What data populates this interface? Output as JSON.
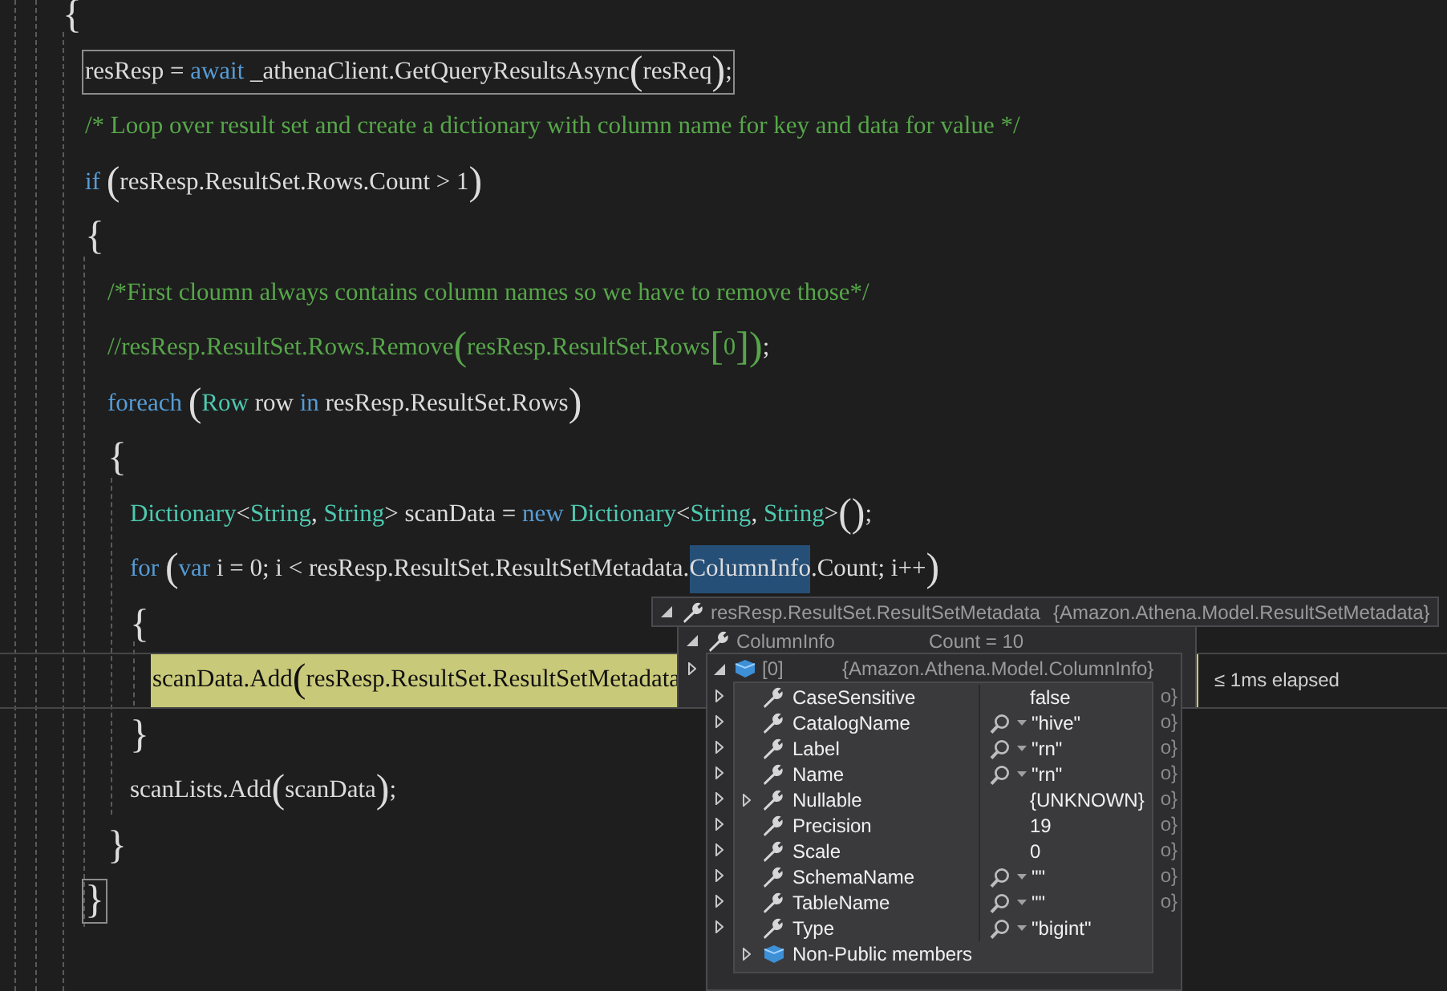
{
  "code": [
    {
      "tokens": [
        {
          "text": "{",
          "kind": "brace"
        }
      ],
      "boxed": false,
      "current": false
    },
    {
      "children": [
        {
          "tokens": [
            {
              "text": "resResp = ",
              "kind": "plain"
            },
            {
              "text": "await",
              "kind": "keyword"
            },
            {
              "text": " _athenaClient.GetQueryResultsAsync",
              "kind": "plain"
            },
            {
              "text": "(",
              "kind": "paren"
            },
            {
              "text": "resReq",
              "kind": "plain"
            },
            {
              "text": ")",
              "kind": "paren"
            },
            {
              "text": ";",
              "kind": "plain"
            }
          ],
          "boxed": true,
          "current": false
        },
        {
          "tokens": [
            {
              "text": "/* Loop over result set and create a dictionary with column name for key and data for value */",
              "kind": "comment"
            }
          ],
          "boxed": false,
          "current": false
        },
        {
          "tokens": [
            {
              "text": "if ",
              "kind": "keyword"
            },
            {
              "text": "(",
              "kind": "paren"
            },
            {
              "text": "resResp.ResultSet.Rows.Count > 1",
              "kind": "plain"
            },
            {
              "text": ")",
              "kind": "paren"
            }
          ],
          "boxed": false,
          "current": false
        },
        {
          "tokens": [
            {
              "text": "{",
              "kind": "brace"
            }
          ],
          "boxed": false,
          "current": false
        },
        {
          "children": [
            {
              "tokens": [
                {
                  "text": "/*First cloumn always contains column names so we have to remove those*/",
                  "kind": "comment"
                }
              ],
              "boxed": false,
              "current": false
            },
            {
              "tokens": [
                {
                  "text": "//resResp.ResultSet.Rows.Remove",
                  "kind": "comment"
                },
                {
                  "text": "(",
                  "kind": "comment_paren"
                },
                {
                  "text": "resResp.ResultSet.Rows",
                  "kind": "comment"
                },
                {
                  "text": "[",
                  "kind": "comment_paren"
                },
                {
                  "text": "0",
                  "kind": "comment"
                },
                {
                  "text": "]",
                  "kind": "comment_paren"
                },
                {
                  "text": ")",
                  "kind": "comment_paren"
                },
                {
                  "text": ";",
                  "kind": "plain"
                }
              ],
              "boxed": false,
              "current": false
            },
            {
              "tokens": [
                {
                  "text": "foreach ",
                  "kind": "keyword"
                },
                {
                  "text": "(",
                  "kind": "paren"
                },
                {
                  "text": "Row",
                  "kind": "type"
                },
                {
                  "text": " row ",
                  "kind": "plain"
                },
                {
                  "text": "in",
                  "kind": "keyword"
                },
                {
                  "text": " resResp.ResultSet.Rows",
                  "kind": "plain"
                },
                {
                  "text": ")",
                  "kind": "paren"
                }
              ],
              "boxed": false,
              "current": false
            },
            {
              "tokens": [
                {
                  "text": "{",
                  "kind": "brace"
                }
              ],
              "boxed": false,
              "current": false
            },
            {
              "children": [
                {
                  "tokens": [
                    {
                      "text": "Dictionary",
                      "kind": "type"
                    },
                    {
                      "text": "<",
                      "kind": "plain"
                    },
                    {
                      "text": "String",
                      "kind": "type"
                    },
                    {
                      "text": ", ",
                      "kind": "plain"
                    },
                    {
                      "text": "String",
                      "kind": "type"
                    },
                    {
                      "text": "> scanData = ",
                      "kind": "plain"
                    },
                    {
                      "text": "new",
                      "kind": "keyword"
                    },
                    {
                      "text": " Dictionary",
                      "kind": "type"
                    },
                    {
                      "text": "<",
                      "kind": "plain"
                    },
                    {
                      "text": "String",
                      "kind": "type"
                    },
                    {
                      "text": ", ",
                      "kind": "plain"
                    },
                    {
                      "text": "String",
                      "kind": "type"
                    },
                    {
                      "text": ">",
                      "kind": "plain"
                    },
                    {
                      "text": "(",
                      "kind": "paren"
                    },
                    {
                      "text": ")",
                      "kind": "paren"
                    },
                    {
                      "text": ";",
                      "kind": "plain"
                    }
                  ],
                  "boxed": false,
                  "current": false
                },
                {
                  "tokens": [
                    {
                      "text": "for ",
                      "kind": "keyword"
                    },
                    {
                      "text": "(",
                      "kind": "paren"
                    },
                    {
                      "text": "var",
                      "kind": "keyword"
                    },
                    {
                      "text": " i = 0; i < resResp.ResultSet.ResultSetMetadata.",
                      "kind": "plain"
                    },
                    {
                      "text": "ColumnInfo",
                      "kind": "highlight"
                    },
                    {
                      "text": ".Count; i++",
                      "kind": "plain"
                    },
                    {
                      "text": ")",
                      "kind": "paren"
                    }
                  ],
                  "boxed": false,
                  "current": false
                },
                {
                  "tokens": [
                    {
                      "text": "{",
                      "kind": "brace"
                    }
                  ],
                  "boxed": false,
                  "current": false
                },
                {
                  "children": [
                    {
                      "tokens": [
                        {
                          "text": "scanData.Add",
                          "kind": "plain"
                        },
                        {
                          "text": "(",
                          "kind": "paren"
                        },
                        {
                          "text": "resResp.ResultSet.ResultSetMetadata",
                          "kind": "plain"
                        }
                      ],
                      "boxed": false,
                      "current": true
                    }
                  ]
                },
                {
                  "tokens": [
                    {
                      "text": "}",
                      "kind": "brace"
                    }
                  ],
                  "boxed": false,
                  "current": false
                },
                {
                  "tokens": [
                    {
                      "text": "scanLists.Add",
                      "kind": "plain"
                    },
                    {
                      "text": "(",
                      "kind": "paren"
                    },
                    {
                      "text": "scanData",
                      "kind": "plain"
                    },
                    {
                      "text": ")",
                      "kind": "paren"
                    },
                    {
                      "text": ";",
                      "kind": "plain"
                    }
                  ],
                  "boxed": false,
                  "current": false
                }
              ]
            },
            {
              "tokens": [
                {
                  "text": "}",
                  "kind": "brace"
                }
              ],
              "boxed": false,
              "current": false
            }
          ]
        },
        {
          "tokens": [
            {
              "text": "}",
              "kind": "brace"
            }
          ],
          "boxed": true,
          "current": false
        }
      ]
    }
  ],
  "elapsed": "≤ 1ms elapsed",
  "datatip": {
    "name": "resResp.ResultSet.ResultSetMetadata",
    "value": "{Amazon.Athena.Model.ResultSetMetadata}",
    "expanded": true,
    "kind": "property",
    "children": [
      {
        "name": "ColumnInfo",
        "value": "Count = 10",
        "expanded": true,
        "kind": "property"
      },
      {
        "expanded": false
      }
    ],
    "items": [
      {
        "name": "[0]",
        "value": "{Amazon.Athena.Model.ColumnInfo}",
        "expanded": true,
        "kind": "object"
      },
      {
        "value": "o}",
        "expanded": false
      },
      {
        "value": "o}",
        "expanded": false
      },
      {
        "value": "o}",
        "expanded": false
      },
      {
        "value": "o}",
        "expanded": false
      },
      {
        "value": "o}",
        "expanded": false
      },
      {
        "value": "o}",
        "expanded": false
      },
      {
        "value": "o}",
        "expanded": false
      },
      {
        "value": "o}",
        "expanded": false
      },
      {
        "value": "o}",
        "expanded": false
      },
      {
        "expanded": false
      }
    ],
    "members": [
      {
        "name": "CaseSensitive",
        "value": "false",
        "kind": "property",
        "visualizer": false,
        "expandable": false
      },
      {
        "name": "CatalogName",
        "value": "\"hive\"",
        "kind": "property",
        "visualizer": true,
        "expandable": false
      },
      {
        "name": "Label",
        "value": "\"rn\"",
        "kind": "property",
        "visualizer": true,
        "expandable": false
      },
      {
        "name": "Name",
        "value": "\"rn\"",
        "kind": "property",
        "visualizer": true,
        "expandable": false
      },
      {
        "name": "Nullable",
        "value": "{UNKNOWN}",
        "kind": "property",
        "visualizer": false,
        "expandable": true
      },
      {
        "name": "Precision",
        "value": "19",
        "kind": "property",
        "visualizer": false,
        "expandable": false
      },
      {
        "name": "Scale",
        "value": "0",
        "kind": "property",
        "visualizer": false,
        "expandable": false
      },
      {
        "name": "SchemaName",
        "value": "\"\"",
        "kind": "property",
        "visualizer": true,
        "expandable": false
      },
      {
        "name": "TableName",
        "value": "\"\"",
        "kind": "property",
        "visualizer": true,
        "expandable": false
      },
      {
        "name": "Type",
        "value": "\"bigint\"",
        "kind": "property",
        "visualizer": true,
        "expandable": false
      },
      {
        "name": "Non-Public members",
        "kind": "object",
        "expandable": true
      }
    ]
  }
}
